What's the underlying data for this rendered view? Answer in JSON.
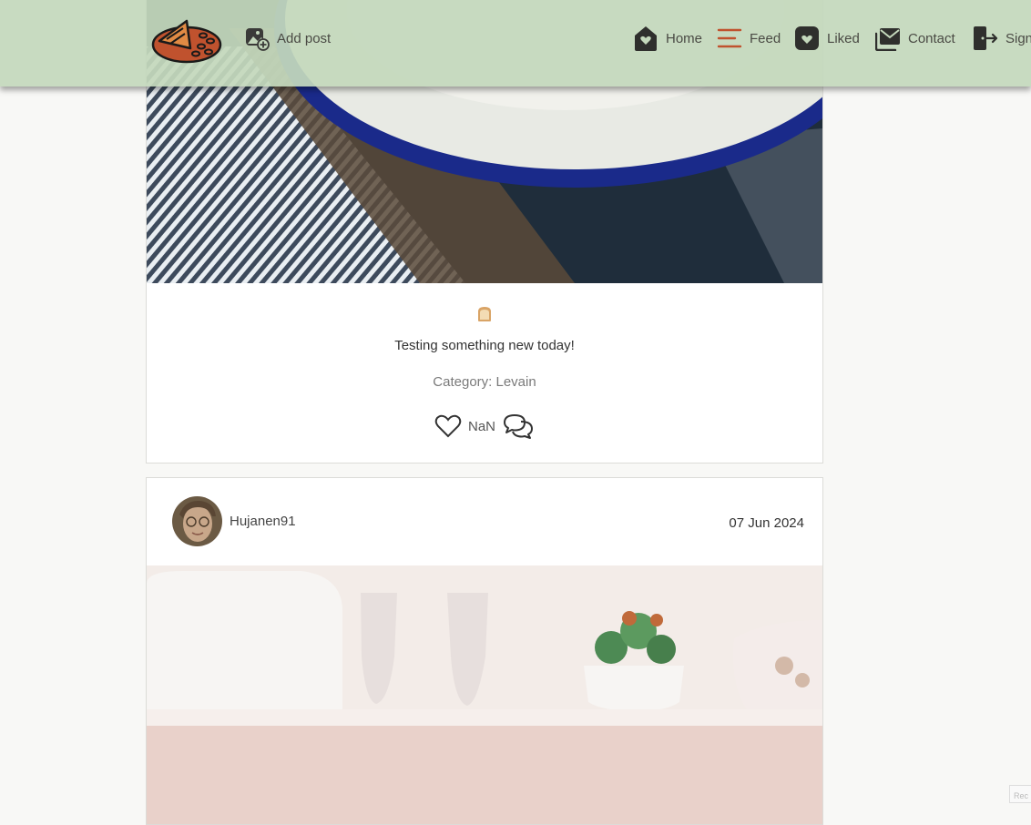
{
  "nav": {
    "add_post": "Add post",
    "home": "Home",
    "feed": "Feed",
    "liked": "Liked",
    "contact": "Contact",
    "sign_out": "Sign"
  },
  "posts": [
    {
      "caption": "Testing something new today!",
      "category": "Category: Levain",
      "likes": "NaN"
    },
    {
      "username": "Hujanen91",
      "date": "07 Jun 2024"
    }
  ],
  "recaptcha_label": "Rec"
}
